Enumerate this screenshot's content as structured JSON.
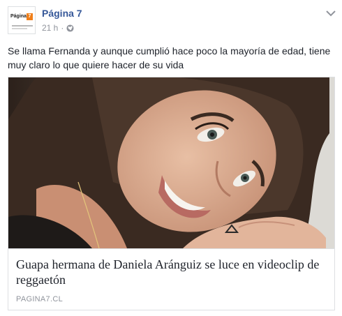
{
  "header": {
    "page_name": "Página 7",
    "timestamp": "21 h",
    "separator": "·",
    "privacy_icon": "globe-icon",
    "menu_icon": "chevron-down-icon",
    "avatar_logo_text": "Página",
    "avatar_logo_badge": "7"
  },
  "post": {
    "text": "Se llama Fernanda y aunque cumplió hace poco la mayoría de edad, tiene muy claro lo que quiere hacer de su vida"
  },
  "link_card": {
    "image_subject": "young woman smiling, resting her head on her hand",
    "title": "Guapa hermana de Daniela Aránguiz se luce en videoclip de reggaetón",
    "domain": "PAGINA7.CL"
  },
  "colors": {
    "link_blue": "#365899",
    "meta_gray": "#90949c",
    "text": "#1d2129",
    "border": "#dddfe2",
    "brand_orange": "#f07f1a"
  }
}
